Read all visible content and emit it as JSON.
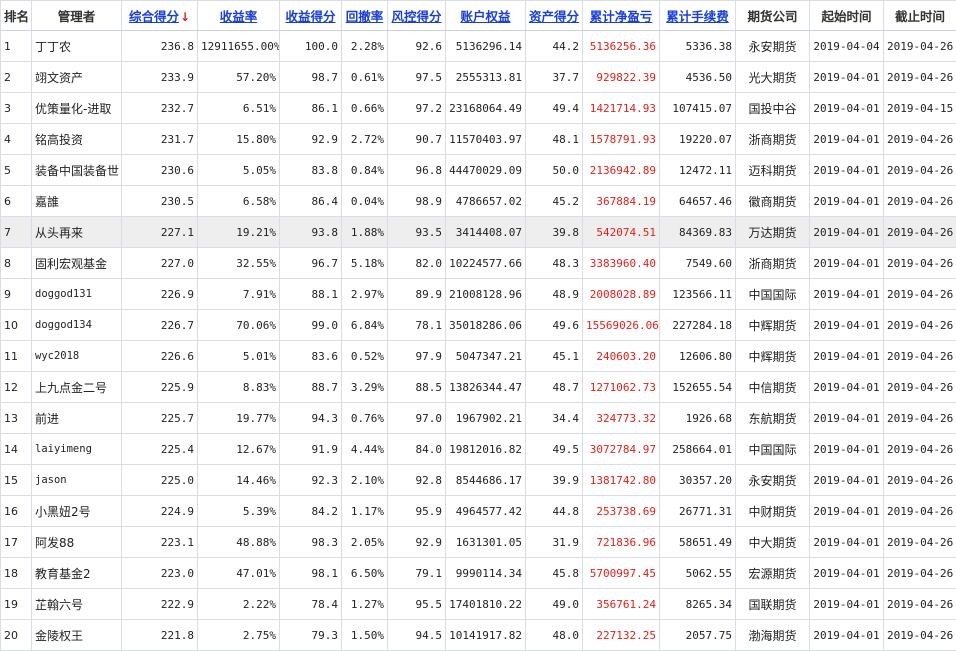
{
  "headers": [
    "排名",
    "管理者",
    "综合得分",
    "收益率",
    "收益得分",
    "回撤率",
    "风控得分",
    "账户权益",
    "资产得分",
    "累计净盈亏",
    "累计手续费",
    "期货公司",
    "起始时间",
    "截止时间"
  ],
  "sort_arrow": "↓",
  "colors": {
    "link": "#1a3fd6",
    "profit": "#e0201a",
    "highlight_row": "#eeeeee"
  },
  "rows": [
    {
      "rank": "1",
      "manager": "丁丁农",
      "score": "236.8",
      "return_rate": "12911655.00%",
      "return_score": "100.0",
      "drawdown": "2.28%",
      "risk_score": "92.6",
      "equity": "5136296.14",
      "asset_score": "44.2",
      "net_pnl": "5136256.36",
      "fees": "5336.38",
      "company": "永安期货",
      "start": "2019-04-04",
      "end": "2019-04-26"
    },
    {
      "rank": "2",
      "manager": "翊文资产",
      "score": "233.9",
      "return_rate": "57.20%",
      "return_score": "98.7",
      "drawdown": "0.61%",
      "risk_score": "97.5",
      "equity": "2555313.81",
      "asset_score": "37.7",
      "net_pnl": "929822.39",
      "fees": "4536.50",
      "company": "光大期货",
      "start": "2019-04-01",
      "end": "2019-04-26"
    },
    {
      "rank": "3",
      "manager": "优策量化-进取",
      "score": "232.7",
      "return_rate": "6.51%",
      "return_score": "86.1",
      "drawdown": "0.66%",
      "risk_score": "97.2",
      "equity": "23168064.49",
      "asset_score": "49.4",
      "net_pnl": "1421714.93",
      "fees": "107415.07",
      "company": "国投中谷",
      "start": "2019-04-01",
      "end": "2019-04-15"
    },
    {
      "rank": "4",
      "manager": "铭高投资",
      "score": "231.7",
      "return_rate": "15.80%",
      "return_score": "92.9",
      "drawdown": "2.72%",
      "risk_score": "90.7",
      "equity": "11570403.97",
      "asset_score": "48.1",
      "net_pnl": "1578791.93",
      "fees": "19220.07",
      "company": "浙商期货",
      "start": "2019-04-01",
      "end": "2019-04-26"
    },
    {
      "rank": "5",
      "manager": "装备中国装备世",
      "score": "230.6",
      "return_rate": "5.05%",
      "return_score": "83.8",
      "drawdown": "0.84%",
      "risk_score": "96.8",
      "equity": "44470029.09",
      "asset_score": "50.0",
      "net_pnl": "2136942.89",
      "fees": "12472.11",
      "company": "迈科期货",
      "start": "2019-04-01",
      "end": "2019-04-26"
    },
    {
      "rank": "6",
      "manager": "嘉誰",
      "score": "230.5",
      "return_rate": "6.58%",
      "return_score": "86.4",
      "drawdown": "0.04%",
      "risk_score": "98.9",
      "equity": "4786657.02",
      "asset_score": "45.2",
      "net_pnl": "367884.19",
      "fees": "64657.46",
      "company": "徽商期货",
      "start": "2019-04-01",
      "end": "2019-04-26"
    },
    {
      "rank": "7",
      "manager": "从头再来",
      "score": "227.1",
      "return_rate": "19.21%",
      "return_score": "93.8",
      "drawdown": "1.88%",
      "risk_score": "93.5",
      "equity": "3414408.07",
      "asset_score": "39.8",
      "net_pnl": "542074.51",
      "fees": "84369.83",
      "company": "万达期货",
      "start": "2019-04-01",
      "end": "2019-04-26"
    },
    {
      "rank": "8",
      "manager": "固利宏观基金",
      "score": "227.0",
      "return_rate": "32.55%",
      "return_score": "96.7",
      "drawdown": "5.18%",
      "risk_score": "82.0",
      "equity": "10224577.66",
      "asset_score": "48.3",
      "net_pnl": "3383960.40",
      "fees": "7549.60",
      "company": "浙商期货",
      "start": "2019-04-01",
      "end": "2019-04-26"
    },
    {
      "rank": "9",
      "manager": "doggod131",
      "score": "226.9",
      "return_rate": "7.91%",
      "return_score": "88.1",
      "drawdown": "2.97%",
      "risk_score": "89.9",
      "equity": "21008128.96",
      "asset_score": "48.9",
      "net_pnl": "2008028.89",
      "fees": "123566.11",
      "company": "中国国际",
      "start": "2019-04-01",
      "end": "2019-04-26"
    },
    {
      "rank": "10",
      "manager": "doggod134",
      "score": "226.7",
      "return_rate": "70.06%",
      "return_score": "99.0",
      "drawdown": "6.84%",
      "risk_score": "78.1",
      "equity": "35018286.06",
      "asset_score": "49.6",
      "net_pnl": "15569026.06",
      "fees": "227284.18",
      "company": "中辉期货",
      "start": "2019-04-01",
      "end": "2019-04-26"
    },
    {
      "rank": "11",
      "manager": "wyc2018",
      "score": "226.6",
      "return_rate": "5.01%",
      "return_score": "83.6",
      "drawdown": "0.52%",
      "risk_score": "97.9",
      "equity": "5047347.21",
      "asset_score": "45.1",
      "net_pnl": "240603.20",
      "fees": "12606.80",
      "company": "中辉期货",
      "start": "2019-04-01",
      "end": "2019-04-26"
    },
    {
      "rank": "12",
      "manager": "上九点金二号",
      "score": "225.9",
      "return_rate": "8.83%",
      "return_score": "88.7",
      "drawdown": "3.29%",
      "risk_score": "88.5",
      "equity": "13826344.47",
      "asset_score": "48.7",
      "net_pnl": "1271062.73",
      "fees": "152655.54",
      "company": "中信期货",
      "start": "2019-04-01",
      "end": "2019-04-26"
    },
    {
      "rank": "13",
      "manager": "前进",
      "score": "225.7",
      "return_rate": "19.77%",
      "return_score": "94.3",
      "drawdown": "0.76%",
      "risk_score": "97.0",
      "equity": "1967902.21",
      "asset_score": "34.4",
      "net_pnl": "324773.32",
      "fees": "1926.68",
      "company": "东航期货",
      "start": "2019-04-01",
      "end": "2019-04-26"
    },
    {
      "rank": "14",
      "manager": "laiyimeng",
      "score": "225.4",
      "return_rate": "12.67%",
      "return_score": "91.9",
      "drawdown": "4.44%",
      "risk_score": "84.0",
      "equity": "19812016.82",
      "asset_score": "49.5",
      "net_pnl": "3072784.97",
      "fees": "258664.01",
      "company": "中国国际",
      "start": "2019-04-01",
      "end": "2019-04-26"
    },
    {
      "rank": "15",
      "manager": "jason",
      "score": "225.0",
      "return_rate": "14.46%",
      "return_score": "92.3",
      "drawdown": "2.10%",
      "risk_score": "92.8",
      "equity": "8544686.17",
      "asset_score": "39.9",
      "net_pnl": "1381742.80",
      "fees": "30357.20",
      "company": "永安期货",
      "start": "2019-04-01",
      "end": "2019-04-26"
    },
    {
      "rank": "16",
      "manager": "小黑妞2号",
      "score": "224.9",
      "return_rate": "5.39%",
      "return_score": "84.2",
      "drawdown": "1.17%",
      "risk_score": "95.9",
      "equity": "4964577.42",
      "asset_score": "44.8",
      "net_pnl": "253738.69",
      "fees": "26771.31",
      "company": "中财期货",
      "start": "2019-04-01",
      "end": "2019-04-26"
    },
    {
      "rank": "17",
      "manager": "阿发88",
      "score": "223.1",
      "return_rate": "48.88%",
      "return_score": "98.3",
      "drawdown": "2.05%",
      "risk_score": "92.9",
      "equity": "1631301.05",
      "asset_score": "31.9",
      "net_pnl": "721836.96",
      "fees": "58651.49",
      "company": "中大期货",
      "start": "2019-04-01",
      "end": "2019-04-26"
    },
    {
      "rank": "18",
      "manager": "教育基金2",
      "score": "223.0",
      "return_rate": "47.01%",
      "return_score": "98.1",
      "drawdown": "6.50%",
      "risk_score": "79.1",
      "equity": "9990114.34",
      "asset_score": "45.8",
      "net_pnl": "5700997.45",
      "fees": "5062.55",
      "company": "宏源期货",
      "start": "2019-04-01",
      "end": "2019-04-26"
    },
    {
      "rank": "19",
      "manager": "芷翰六号",
      "score": "222.9",
      "return_rate": "2.22%",
      "return_score": "78.4",
      "drawdown": "1.27%",
      "risk_score": "95.5",
      "equity": "17401810.22",
      "asset_score": "49.0",
      "net_pnl": "356761.24",
      "fees": "8265.34",
      "company": "国联期货",
      "start": "2019-04-01",
      "end": "2019-04-26"
    },
    {
      "rank": "20",
      "manager": "金陵权王",
      "score": "221.8",
      "return_rate": "2.75%",
      "return_score": "79.3",
      "drawdown": "1.50%",
      "risk_score": "94.5",
      "equity": "10141917.82",
      "asset_score": "48.0",
      "net_pnl": "227132.25",
      "fees": "2057.75",
      "company": "渤海期货",
      "start": "2019-04-01",
      "end": "2019-04-26"
    }
  ]
}
